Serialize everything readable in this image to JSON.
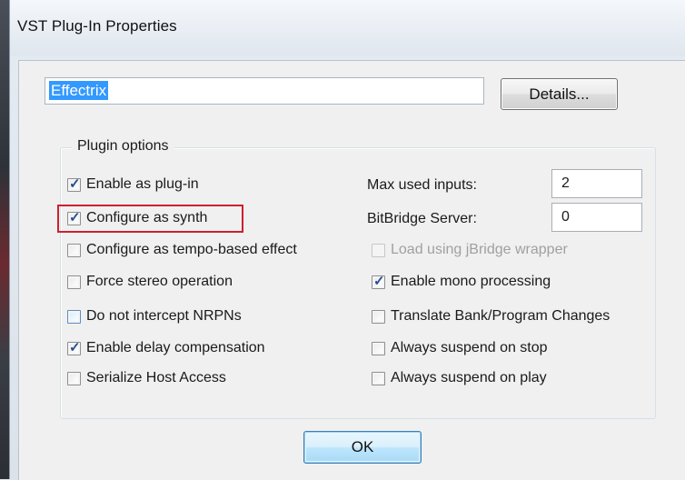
{
  "window": {
    "title": "VST Plug-In Properties"
  },
  "plugin_name": {
    "value": "Effectrix"
  },
  "buttons": {
    "details": "Details...",
    "ok": "OK"
  },
  "plugin_options": {
    "label": "Plugin options",
    "left": [
      {
        "label": "Enable as plug-in",
        "checked": true
      },
      {
        "label": "Configure as synth",
        "checked": true,
        "highlighted": true
      },
      {
        "label": "Configure as tempo-based effect",
        "checked": false
      },
      {
        "label": "Force stereo operation",
        "checked": false
      },
      {
        "label": "Do not intercept NRPNs",
        "checked": false
      },
      {
        "label": "Enable delay compensation",
        "checked": true
      },
      {
        "label": "Serialize Host Access",
        "checked": false
      }
    ],
    "right": {
      "max_used_inputs": {
        "label": "Max used inputs:",
        "value": "2"
      },
      "bitbridge_server": {
        "label": "BitBridge Server:",
        "value": "0"
      },
      "checks": [
        {
          "label": "Load using jBridge wrapper",
          "checked": false,
          "disabled": true
        },
        {
          "label": "Enable mono processing",
          "checked": true
        },
        {
          "label": "Translate Bank/Program Changes",
          "checked": false
        },
        {
          "label": "Always suspend on stop",
          "checked": false
        },
        {
          "label": "Always suspend on play",
          "checked": false
        }
      ]
    }
  },
  "colors": {
    "highlight": "#cc2030",
    "selection": "#3399ff"
  }
}
